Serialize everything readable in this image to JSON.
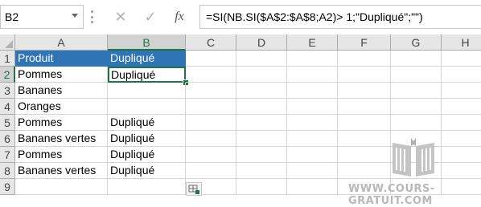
{
  "formula_bar": {
    "name_box": "B2",
    "cancel_icon": "✕",
    "enter_icon": "✓",
    "fx_label": "fx",
    "formula": "=SI(NB.SI($A$2:$A$8;A2)> 1;\"Dupliqué\";\"\")"
  },
  "columns": [
    "A",
    "B",
    "C",
    "D",
    "E",
    "F",
    "G",
    "H"
  ],
  "rows": [
    {
      "num": "1",
      "a": "Produit",
      "b": "Dupliqué"
    },
    {
      "num": "2",
      "a": "Pommes",
      "b": "Dupliqué"
    },
    {
      "num": "3",
      "a": "Bananes",
      "b": ""
    },
    {
      "num": "4",
      "a": "Oranges",
      "b": ""
    },
    {
      "num": "5",
      "a": "Pommes",
      "b": "Dupliqué"
    },
    {
      "num": "6",
      "a": "Bananes vertes",
      "b": "Dupliqué"
    },
    {
      "num": "7",
      "a": "Pommes",
      "b": "Dupliqué"
    },
    {
      "num": "8",
      "a": "Bananes vertes",
      "b": "Dupliqué"
    },
    {
      "num": "9",
      "a": "",
      "b": ""
    }
  ],
  "selection": {
    "cell": "B2",
    "column": "B",
    "row": "2"
  },
  "colors": {
    "header_fill": "#2f75b5",
    "selection": "#217346"
  },
  "watermark": {
    "text": "WWW.COURS-GRATUIT.COM",
    "logo_icon": "book-icon"
  }
}
